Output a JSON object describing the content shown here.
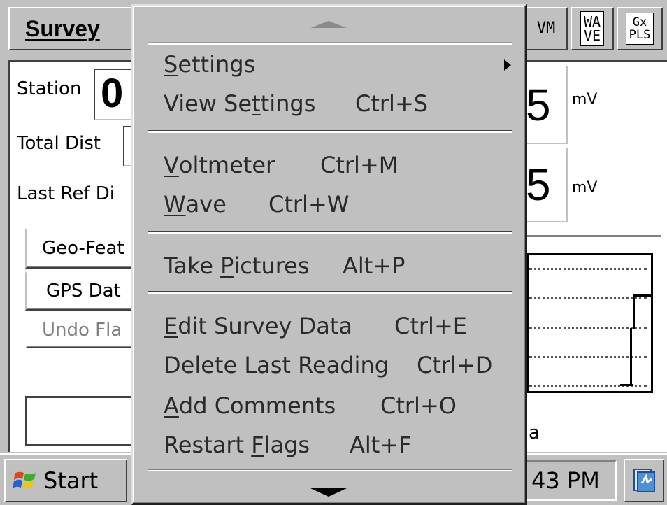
{
  "menubar": {
    "survey_label": "Survey",
    "buttons": [
      {
        "name": "vm",
        "lines": [
          "VM"
        ]
      },
      {
        "name": "wave",
        "lines": [
          "WA",
          "VE"
        ]
      },
      {
        "name": "gx-pls",
        "lines": [
          "Gx",
          "PLS"
        ]
      }
    ]
  },
  "form": {
    "station_label": "Station",
    "station_value": "0",
    "total_dist_label": "Total Dist",
    "last_ref_dist_label": "Last Ref Di",
    "reading1": {
      "value": "5",
      "unit": "mV"
    },
    "reading2": {
      "value": "5",
      "unit": "mV"
    },
    "buttons": [
      "Geo-Feat",
      "GPS Dat",
      "Undo Fla"
    ],
    "partial_text": "a"
  },
  "menu": {
    "items": [
      {
        "pre": "",
        "mnemonic": "S",
        "post": "ettings",
        "shortcut": "",
        "submenu": true
      },
      {
        "pre": "View Se",
        "mnemonic": "t",
        "post": "tings",
        "shortcut": "Ctrl+S"
      },
      {
        "pre": "",
        "mnemonic": "V",
        "post": "oltmeter",
        "shortcut": "Ctrl+M"
      },
      {
        "pre": "",
        "mnemonic": "W",
        "post": "ave",
        "shortcut": "Ctrl+W"
      },
      {
        "pre": "Take ",
        "mnemonic": "P",
        "post": "ictures",
        "shortcut": "Alt+P"
      },
      {
        "pre": "",
        "mnemonic": "E",
        "post": "dit Survey Data",
        "shortcut": "Ctrl+E"
      },
      {
        "pre": "Delete Last Reading",
        "mnemonic": "",
        "post": "",
        "shortcut": "Ctrl+D"
      },
      {
        "pre": "",
        "mnemonic": "A",
        "post": "dd Comments",
        "shortcut": "Ctrl+O"
      },
      {
        "pre": "Restart ",
        "mnemonic": "F",
        "post": "lags",
        "shortcut": "Alt+F"
      }
    ]
  },
  "taskbar": {
    "start_label": "Start",
    "clock": "43 PM"
  },
  "colors": {
    "face": "#c0c0c0",
    "shadow": "#404040",
    "highlight": "#ffffff",
    "menu_text": "#2a2a2a"
  }
}
